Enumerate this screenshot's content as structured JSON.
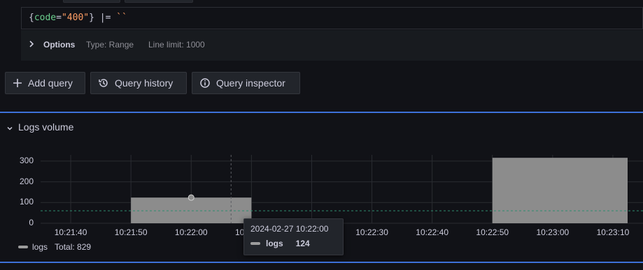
{
  "query": {
    "code_open": "{",
    "code_key": "code",
    "code_eq": "=",
    "code_value": "\"400\"",
    "code_close": "}",
    "code_op": " |= ",
    "code_literal": "``"
  },
  "options": {
    "label": "Options",
    "type": "Type: Range",
    "line_limit": "Line limit: 1000"
  },
  "toolbar": {
    "add_query": "Add query",
    "query_history": "Query history",
    "query_inspector": "Query inspector"
  },
  "logs_volume": {
    "title": "Logs volume",
    "legend_series": "logs",
    "legend_total": "Total: 829"
  },
  "tooltip": {
    "time": "2024-02-27 10:22:00",
    "series": "logs",
    "value": "124"
  },
  "chart_data": {
    "type": "bar",
    "ytick_labels": [
      "0",
      "100",
      "200",
      "300"
    ],
    "xtick_labels": [
      "10:21:40",
      "10:21:50",
      "10:22:00",
      "10:22:10",
      "10:22:20",
      "10:22:30",
      "10:22:40",
      "10:22:50",
      "10:23:00",
      "10:23:10"
    ],
    "xlim": [
      "10:21:35",
      "10:23:15"
    ],
    "ylim": [
      0,
      330
    ],
    "grid": true,
    "series": [
      {
        "name": "logs",
        "color": "#8c8c8c",
        "bars": [
          {
            "start": "10:21:50",
            "end": "10:22:10",
            "value": 124
          },
          {
            "start": "10:22:50",
            "end": "10:23:15",
            "value": 316
          }
        ]
      }
    ],
    "threshold_value": 60,
    "hover_time": "10:22:00",
    "legend_placement": "bottom-left"
  },
  "colors": {
    "accent_line": "#3d71d9",
    "bar": "#8c8c8c",
    "threshold": "#2f8c6f"
  }
}
